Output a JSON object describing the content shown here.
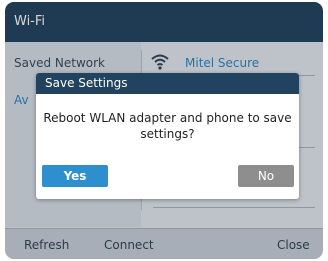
{
  "window": {
    "title": "Wi-Fi"
  },
  "left_list": {
    "items": [
      "Saved Network",
      "Av"
    ]
  },
  "network": {
    "name": "Mitel Secure",
    "icon": "wifi-icon"
  },
  "softkeys": {
    "refresh": "Refresh",
    "connect": "Connect",
    "close": "Close"
  },
  "dialog": {
    "title": "Save Settings",
    "message": "Reboot WLAN adapter and phone to save settings?",
    "yes_label": "Yes",
    "no_label": "No"
  },
  "colors": {
    "primary": "#21435f",
    "accent": "#2d8fcd",
    "secondary_button": "#8e8e8e"
  }
}
